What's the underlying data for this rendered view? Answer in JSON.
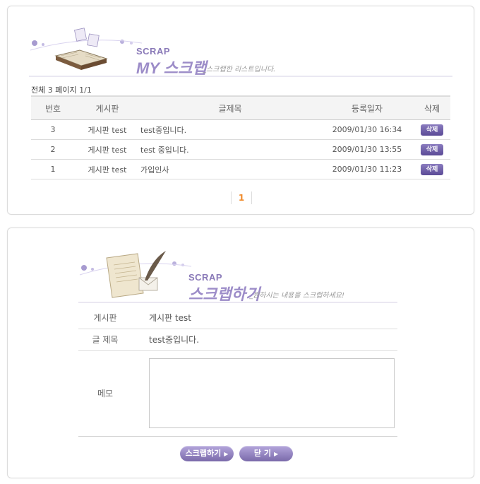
{
  "list_section": {
    "banner": {
      "tag": "SCRAP",
      "title": "MY 스크랩",
      "subtitle": "_스크랩한 리스트입니다."
    },
    "summary": {
      "total_label": "전체",
      "total_count": "3",
      "page_label": "페이지",
      "page_value": "1/1"
    },
    "table": {
      "headers": [
        "번호",
        "게시판",
        "글제목",
        "등록일자",
        "삭제"
      ],
      "rows": [
        {
          "no": "3",
          "board": "게시판 test",
          "title": "test중입니다.",
          "date": "2009/01/30 16:34",
          "delete": "삭제"
        },
        {
          "no": "2",
          "board": "게시판 test",
          "title": "test 중입니다.",
          "date": "2009/01/30 13:55",
          "delete": "삭제"
        },
        {
          "no": "1",
          "board": "게시판 test",
          "title": "가입인사",
          "date": "2009/01/30 11:23",
          "delete": "삭제"
        }
      ]
    },
    "pagination": {
      "current": "1"
    }
  },
  "form_section": {
    "banner": {
      "tag": "SCRAP",
      "title": "스크랩하기",
      "subtitle": "_원하시는 내용을 스크랩하세요!"
    },
    "board": {
      "label": "게시판",
      "value": "게시판 test"
    },
    "subject": {
      "label": "글 제목",
      "value": "test중입니다."
    },
    "memo": {
      "label": "메모",
      "value": ""
    },
    "buttons": {
      "scrap": "스크랩하기",
      "close": "닫 기"
    }
  },
  "colors": {
    "accent_purple": "#8a7ab8",
    "button_purple": "#5a4a96",
    "page_active": "#f08a2a"
  }
}
